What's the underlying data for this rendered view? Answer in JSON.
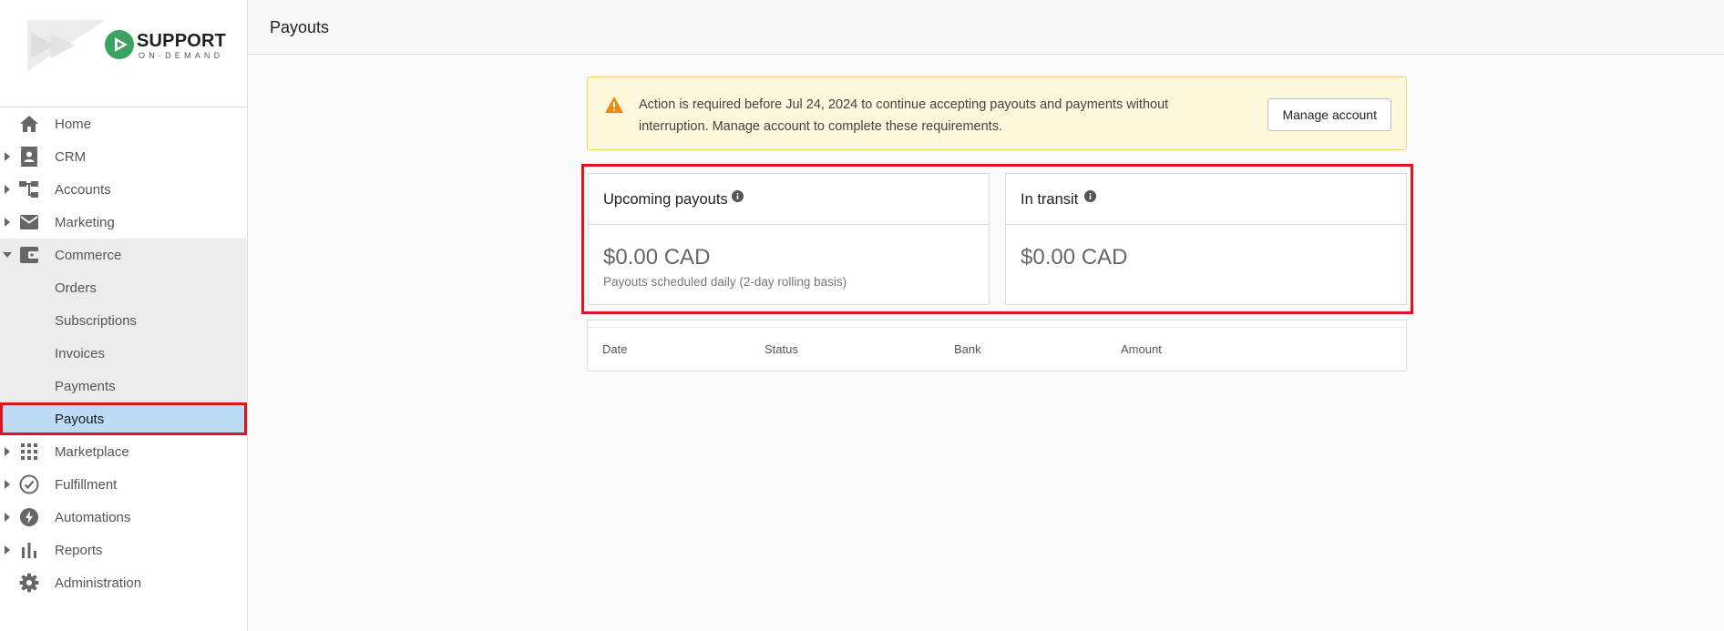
{
  "brand": {
    "name": "SUPPORT",
    "tagline": "ON·DEMAND"
  },
  "sidebar": {
    "items": [
      {
        "label": "Home",
        "icon": "home-icon",
        "has_caret": false
      },
      {
        "label": "CRM",
        "icon": "contact-card-icon",
        "has_caret": true
      },
      {
        "label": "Accounts",
        "icon": "hierarchy-icon",
        "has_caret": true
      },
      {
        "label": "Marketing",
        "icon": "mail-icon",
        "has_caret": true
      },
      {
        "label": "Commerce",
        "icon": "wallet-icon",
        "has_caret": true,
        "expanded": true
      },
      {
        "label": "Marketplace",
        "icon": "grid-icon",
        "has_caret": true
      },
      {
        "label": "Fulfillment",
        "icon": "check-circle-icon",
        "has_caret": true
      },
      {
        "label": "Automations",
        "icon": "bolt-icon",
        "has_caret": true
      },
      {
        "label": "Reports",
        "icon": "bar-chart-icon",
        "has_caret": true
      },
      {
        "label": "Administration",
        "icon": "gear-icon",
        "has_caret": false
      }
    ],
    "commerce_children": [
      "Orders",
      "Subscriptions",
      "Invoices",
      "Payments",
      "Payouts"
    ],
    "active_child": "Payouts"
  },
  "header": {
    "title": "Payouts"
  },
  "alert": {
    "message": "Action is required before Jul 24, 2024 to continue accepting payouts and payments without interruption. Manage account to complete these requirements.",
    "button_label": "Manage account"
  },
  "cards": {
    "upcoming": {
      "title": "Upcoming payouts",
      "amount": "$0.00 CAD",
      "note": "Payouts scheduled daily (2-day rolling basis)"
    },
    "in_transit": {
      "title": "In transit",
      "amount": "$0.00 CAD"
    }
  },
  "table": {
    "columns": [
      "Date",
      "Status",
      "Bank",
      "Amount"
    ]
  },
  "colors": {
    "highlight": "#e0141e",
    "active_bg": "#bcdcf5",
    "alert_bg": "#fdf7dc",
    "warning": "#f0890a",
    "brand_green": "#3aa35f"
  }
}
